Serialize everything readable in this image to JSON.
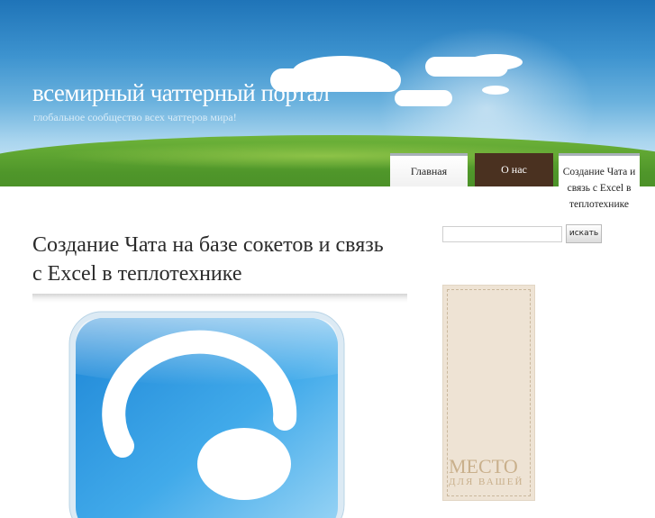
{
  "site": {
    "title": "всемирный чаттерный портал",
    "description": "глобальное сообщество всех чаттеров мира!"
  },
  "nav": {
    "items": [
      {
        "label": "Главная"
      },
      {
        "label": "О нас"
      },
      {
        "label": "Создание Чата и связь с Excel в теплотехнике"
      }
    ]
  },
  "post": {
    "title": "Создание Чата на базе сокетов и связь с Excel в теплотехнике"
  },
  "sidebar": {
    "search_button": "искать",
    "search_value": "",
    "ad_line1": "МЕСТО",
    "ad_line2": "ДЛЯ ВАШЕЙ"
  },
  "colors": {
    "sky": "#3d93cf",
    "grass": "#4f962a",
    "nav_active": "#4a3120",
    "ad_bg": "#eee3d4",
    "icon_blue": "#2f9ee0"
  }
}
